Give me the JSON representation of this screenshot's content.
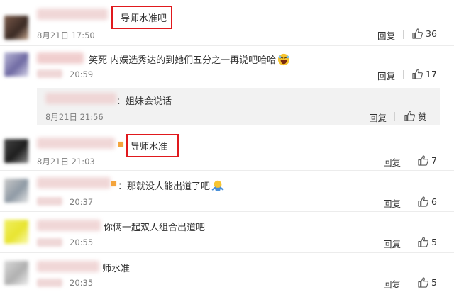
{
  "comments": [
    {
      "text": "导师水准吧",
      "time": "8月21日 17:50",
      "reply": "回复",
      "likes": "36"
    },
    {
      "text": "笑死 内娱选秀达的到她们五分之一再说吧哈哈",
      "time": "20:59",
      "reply": "回复",
      "likes": "17",
      "subcomment": {
        "text": "：姐妹会说话",
        "time": "8月21日 21:56",
        "reply": "回复",
        "likes": "赞"
      }
    },
    {
      "text": "导师水准",
      "time": "8月21日 21:03",
      "reply": "回复",
      "likes": "7"
    },
    {
      "text": "：那就没人能出道了吧",
      "time": "20:37",
      "reply": "回复",
      "likes": "6"
    },
    {
      "text": "你俩一起双人组合出道吧",
      "time": "20:55",
      "reply": "回复",
      "likes": "5"
    },
    {
      "text": "师水准",
      "time": "20:35",
      "reply": "回复",
      "likes": "5"
    }
  ],
  "icons": {
    "like": "thumbs-up-icon",
    "emoji_laugh": "laughing-emoji-icon",
    "emoji_shrug": "shrug-emoji-icon"
  },
  "colors": {
    "highlight": "#e0191d",
    "subbox": "#f2f2f2"
  }
}
